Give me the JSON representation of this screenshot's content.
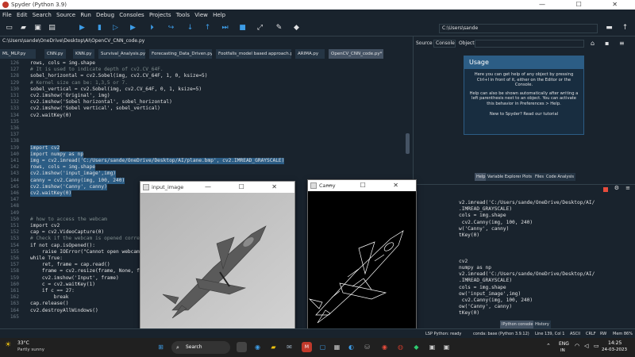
{
  "window": {
    "title": "Spyder (Python 3.9)",
    "controls": "— ☐ ✕"
  },
  "menu": [
    "File",
    "Edit",
    "Search",
    "Source",
    "Run",
    "Debug",
    "Consoles",
    "Projects",
    "Tools",
    "View",
    "Help"
  ],
  "toolbar": {
    "path": "C:\\Users\\sande"
  },
  "editor": {
    "file_path": "C:\\Users\\sande\\OneDrive\\Desktop\\AI\\OpenCV_CNN_code.py",
    "tabs": [
      {
        "label": "ML_MLP.py",
        "active": false
      },
      {
        "label": "CNN.py",
        "active": false
      },
      {
        "label": "KNN.py",
        "active": false
      },
      {
        "label": "Survival_Analysis.py",
        "active": false
      },
      {
        "label": "Forecasting_Data_Driven.py",
        "active": false
      },
      {
        "label": "Footfalls_model based approach.py",
        "active": false
      },
      {
        "label": "ARIMA.py",
        "active": false
      },
      {
        "label": "OpenCV_CNN_code.py*",
        "active": true
      }
    ],
    "lines": [
      {
        "n": "126",
        "t": "rows, cols = img.shape",
        "c": ""
      },
      {
        "n": "127",
        "t": "# It is used to indicate depth of cv2.CV_64F.",
        "c": "cm"
      },
      {
        "n": "128",
        "t": "sobel_horizontal = cv2.Sobel(img, cv2.CV_64F, 1, 0, ksize=5)",
        "c": ""
      },
      {
        "n": "129",
        "t": "# Kernel size can be: 1,3,5 or 7.",
        "c": "cm"
      },
      {
        "n": "130",
        "t": "sobel_vertical = cv2.Sobel(img, cv2.CV_64F, 0, 1, ksize=5)",
        "c": ""
      },
      {
        "n": "131",
        "t": "cv2.imshow('Original', img)",
        "c": ""
      },
      {
        "n": "132",
        "t": "cv2.imshow('Sobel horizontal', sobel_horizontal)",
        "c": ""
      },
      {
        "n": "133",
        "t": "cv2.imshow('Sobel vertical', sobel_vertical)",
        "c": ""
      },
      {
        "n": "134",
        "t": "cv2.waitKey(0)",
        "c": ""
      },
      {
        "n": "135",
        "t": "",
        "c": ""
      },
      {
        "n": "136",
        "t": "",
        "c": ""
      },
      {
        "n": "137",
        "t": "",
        "c": ""
      },
      {
        "n": "138",
        "t": "",
        "c": ""
      },
      {
        "n": "139",
        "t": "import cv2",
        "c": "sel"
      },
      {
        "n": "140",
        "t": "import numpy as np",
        "c": "sel"
      },
      {
        "n": "141",
        "t": "img = cv2.imread('C:/Users/sande/OneDrive/Desktop/AI/plane.bmp', cv2.IMREAD_GRAYSCALE)",
        "c": "sel"
      },
      {
        "n": "142",
        "t": "rows, cols = img.shape",
        "c": "sel"
      },
      {
        "n": "143",
        "t": "cv2.imshow('input_image',img)",
        "c": "sel"
      },
      {
        "n": "144",
        "t": "canny = cv2.Canny(img, 100, 240)",
        "c": "sel"
      },
      {
        "n": "145",
        "t": "cv2.imshow('Canny', canny)",
        "c": "sel"
      },
      {
        "n": "146",
        "t": "cv2.waitKey(0)",
        "c": "sel"
      },
      {
        "n": "147",
        "t": "",
        "c": ""
      },
      {
        "n": "148",
        "t": "",
        "c": ""
      },
      {
        "n": "149",
        "t": "",
        "c": ""
      },
      {
        "n": "150",
        "t": "# how to access the webcam",
        "c": "cm"
      },
      {
        "n": "151",
        "t": "import cv2",
        "c": ""
      },
      {
        "n": "152",
        "t": "cap = cv2.VideoCapture(0)",
        "c": ""
      },
      {
        "n": "153",
        "t": "# Check if the webcam is opened corre",
        "c": "cm"
      },
      {
        "n": "154",
        "t": "if not cap.isOpened():",
        "c": ""
      },
      {
        "n": "155",
        "t": "    raise IOError(\"Cannot open webcam",
        "c": ""
      },
      {
        "n": "156",
        "t": "while True:",
        "c": ""
      },
      {
        "n": "157",
        "t": "    ret, frame = cap.read()",
        "c": ""
      },
      {
        "n": "158",
        "t": "    frame = cv2.resize(frame, None, f",
        "c": ""
      },
      {
        "n": "159",
        "t": "    cv2.imshow('Input', frame)",
        "c": ""
      },
      {
        "n": "160",
        "t": "    c = cv2.waitKey(1)",
        "c": ""
      },
      {
        "n": "161",
        "t": "    if c == 27:",
        "c": ""
      },
      {
        "n": "162",
        "t": "        break",
        "c": ""
      },
      {
        "n": "163",
        "t": "cap.release()",
        "c": ""
      },
      {
        "n": "164",
        "t": "cv2.destroyAllWindows()",
        "c": ""
      },
      {
        "n": "165",
        "t": "",
        "c": ""
      }
    ]
  },
  "help": {
    "source_label": "Source",
    "source_value": "Console",
    "object_label": "Object",
    "usage_title": "Usage",
    "usage_p1": "Here you can get help of any object by pressing Ctrl+I in front of it, either on the Editor or the Console.",
    "usage_p2": "Help can also be shown automatically after writing a left parenthesis next to an object. You can activate this behavior in Preferences > Help.",
    "usage_p3": "New to Spyder? Read our tutorial",
    "tabs": [
      "Help",
      "Variable Explorer",
      "Plots",
      "Files",
      "Code Analysis"
    ]
  },
  "console": {
    "lines": [
      "v2.imread('C:/Users/sande/OneDrive/Desktop/AI/",
      ".IMREAD_GRAYSCALE)",
      "cols = img.shape",
      " cv2.Canny(img, 100, 240)",
      "w('Canny', canny)",
      "tKey(0)",
      "",
      "",
      "",
      "cv2",
      "numpy as np",
      "v2.imread('C:/Users/sande/OneDrive/Desktop/AI/",
      ".IMREAD_GRAYSCALE)",
      "cols = img.shape",
      "ow('input_image',img)",
      " cv2.Canny(img, 100, 240)",
      "ow('Canny', canny)",
      "tKey(0)"
    ],
    "tabs": [
      "IPython console",
      "History"
    ]
  },
  "windows": {
    "input": {
      "title": "input_image",
      "controls": "— ☐ ✕"
    },
    "canny": {
      "title": "Canny",
      "controls": "— ☐ ✕"
    }
  },
  "status": {
    "lsp": "LSP Python: ready",
    "conda": "conda: base (Python 3.9.12)",
    "pos": "Line 139, Col 1",
    "enc": "ASCII",
    "eol": "CRLF",
    "rw": "RW",
    "mem": "Mem 86%"
  },
  "taskbar": {
    "weather_temp": "33°C",
    "weather_desc": "Partly sunny",
    "search": "Search",
    "lang1": "ENG",
    "lang2": "IN",
    "time": "14:25",
    "date": "24-03-2023"
  }
}
